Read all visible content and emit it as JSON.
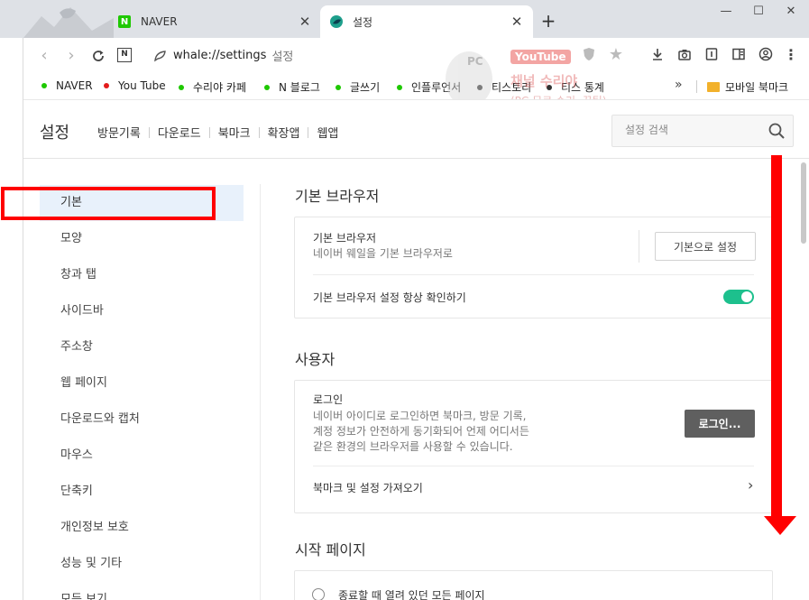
{
  "window": {
    "tabs": [
      {
        "label": "NAVER",
        "favicon": "naver-n-icon"
      },
      {
        "label": "설정",
        "favicon": "whale-icon"
      }
    ],
    "close_glyph": "✕",
    "new_tab_glyph": "+",
    "minimize_glyph": "—",
    "maximize_glyph": "☐",
    "window_close_glyph": "✕"
  },
  "address_bar": {
    "url": "whale://settings",
    "url_suffix": "설정",
    "n_button": "N"
  },
  "bookmarks": [
    {
      "label": "NAVER",
      "color": "#1ec800"
    },
    {
      "label": "You Tube",
      "color": "#e31b1b"
    },
    {
      "label": "수리야 카페",
      "color": "#1ec800"
    },
    {
      "label": "N 블로그",
      "color": "#1ec800"
    },
    {
      "label": "글쓰기",
      "color": "#1ec800"
    },
    {
      "label": "인플루언서",
      "color": "#1ec800"
    },
    {
      "label": "티스토리",
      "color": "#333333"
    },
    {
      "label": "티스 통계",
      "color": "#333333"
    }
  ],
  "bookmarks_more": "»",
  "bookmark_folder": "모바일 북마크",
  "watermark": {
    "badge": "PC",
    "youtube": "YouTube",
    "title": "채널 수리야",
    "subtitle": "(PC 무료 수리, 꿀팁)"
  },
  "header": {
    "title": "설정",
    "nav": [
      "방문기록",
      "다운로드",
      "북마크",
      "확장앱",
      "웹앱"
    ],
    "search_placeholder": "설정 검색"
  },
  "sidebar": {
    "items": [
      "기본",
      "모양",
      "창과 탭",
      "사이드바",
      "주소창",
      "웹 페이지",
      "다운로드와 캡처",
      "마우스",
      "단축키",
      "개인정보 보호",
      "성능 및 기타",
      "모든 보기"
    ],
    "active_index": 0
  },
  "sections": {
    "default_browser": {
      "title": "기본 브라우저",
      "row1_title": "기본 브라우저",
      "row1_desc": "네이버 웨일을 기본 브라우저로",
      "row1_button": "기본으로 설정",
      "row2_title": "기본 브라우저 설정 항상 확인하기",
      "row2_toggle_on": true
    },
    "user": {
      "title": "사용자",
      "login_title": "로그인",
      "login_desc_1": "네이버 아이디로 로그인하면 북마크, 방문 기록,",
      "login_desc_2": "계정 정보가 안전하게 동기화되어 언제 어디서든",
      "login_desc_3": "같은 환경의 브라우저를 사용할 수 있습니다.",
      "login_button": "로그인...",
      "import_label": "북마크 및 설정 가져오기",
      "chevron": "›"
    },
    "start_page": {
      "title": "시작 페이지",
      "option1": "종료할 때 열려 있던 모든 페이지"
    }
  },
  "colors": {
    "accent_toggle": "#1dc08d",
    "active_item_bg": "#e8f1fb",
    "annotation_red": "#ff0000"
  }
}
